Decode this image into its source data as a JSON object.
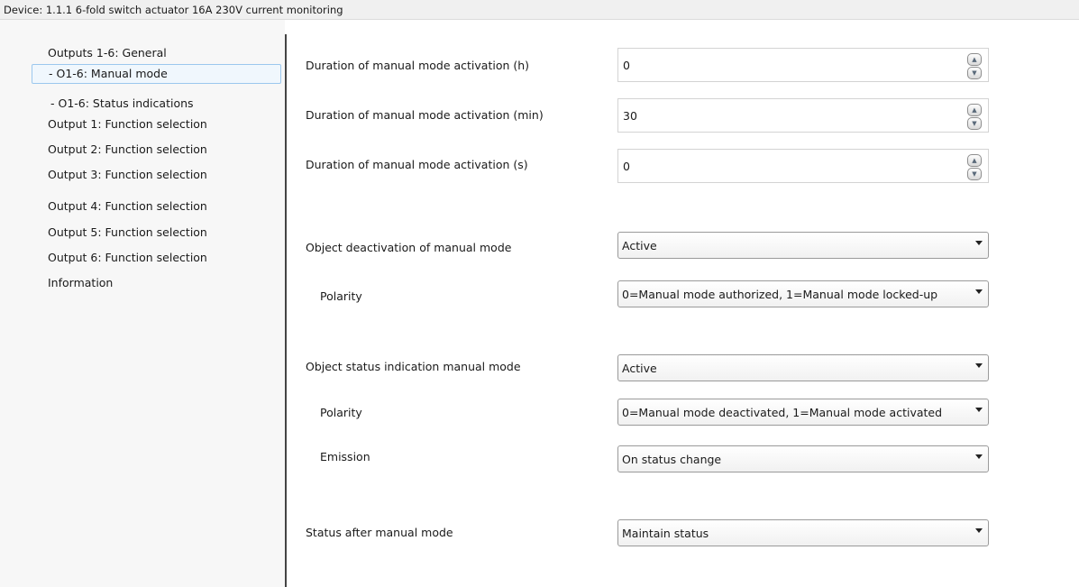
{
  "header": {
    "device": "Device: 1.1.1  6-fold switch actuator 16A 230V current monitoring"
  },
  "sidebar": {
    "items": [
      {
        "label": "Outputs 1-6: General"
      },
      {
        "label": "- O1-6: Manual mode",
        "selected": true
      },
      {
        "label": "- O1-6: Status indications"
      },
      {
        "label": "Output 1: Function selection"
      },
      {
        "label": "Output 2: Function selection"
      },
      {
        "label": "Output 3: Function selection"
      },
      {
        "label": "Output 4: Function selection"
      },
      {
        "label": "Output 5: Function selection"
      },
      {
        "label": "Output 6: Function selection"
      },
      {
        "label": "Information"
      }
    ]
  },
  "params": {
    "duration_h": {
      "label": "Duration of manual mode activation (h)",
      "value": "0"
    },
    "duration_min": {
      "label": "Duration of manual mode activation (min)",
      "value": "30"
    },
    "duration_s": {
      "label": "Duration of manual mode activation (s)",
      "value": "0"
    },
    "object_deactivation": {
      "label": "Object deactivation of manual mode",
      "value": "Active"
    },
    "deactivation_polarity": {
      "label": "Polarity",
      "value": "0=Manual mode authorized, 1=Manual mode locked-up"
    },
    "object_status": {
      "label": "Object status indication manual mode",
      "value": "Active"
    },
    "status_polarity": {
      "label": "Polarity",
      "value": "0=Manual mode deactivated, 1=Manual mode activated"
    },
    "emission": {
      "label": "Emission",
      "value": "On status change"
    },
    "status_after": {
      "label": "Status after manual mode",
      "value": "Maintain status"
    }
  },
  "icons": {
    "spin_up": "spin-up-icon",
    "spin_down": "spin-down-icon",
    "dropdown": "chevron-down-icon"
  },
  "colors": {
    "selected_bg": "#f0f7fd",
    "selected_border": "#9cc8ee",
    "sidebar_bg": "#f7f7f7"
  }
}
